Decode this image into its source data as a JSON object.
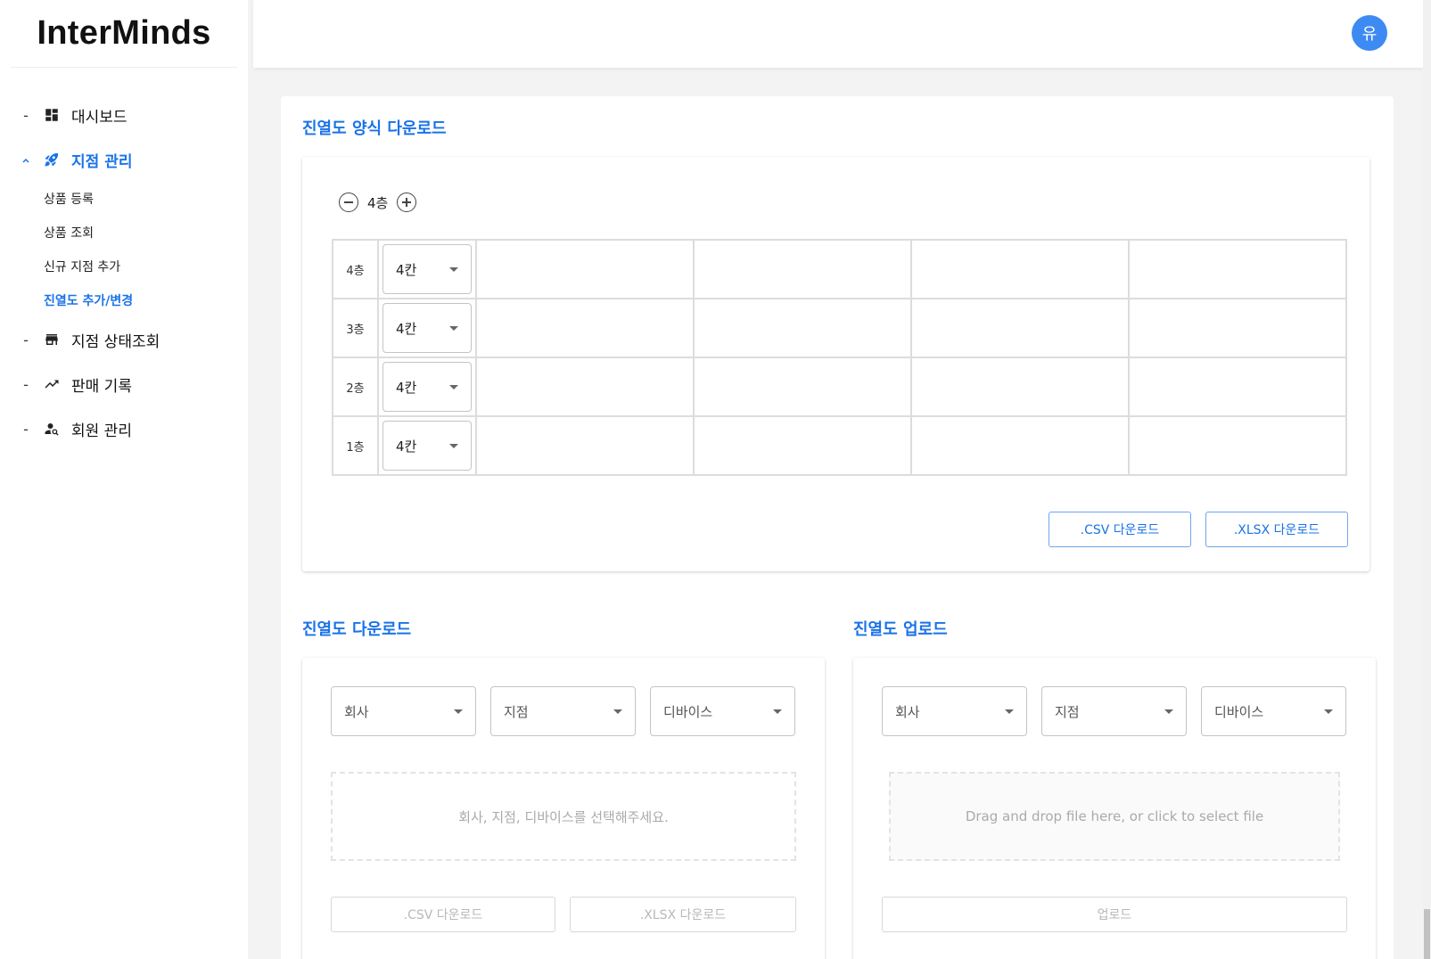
{
  "app": {
    "brand": "InterMinds",
    "avatar_initial": "유"
  },
  "sidebar": {
    "items": [
      {
        "bullet": "-",
        "icon": "dashboard-icon",
        "label": "대시보드"
      },
      {
        "bullet": "^",
        "icon": "rocket-icon",
        "label": "지점 관리",
        "active": true
      },
      {
        "bullet": "-",
        "icon": "store-icon",
        "label": "지점 상태조회"
      },
      {
        "bullet": "-",
        "icon": "trending-up-icon",
        "label": "판매 기록"
      },
      {
        "bullet": "-",
        "icon": "manage-accounts-icon",
        "label": "회원 관리"
      }
    ],
    "sub_items": [
      {
        "label": "상품 등록"
      },
      {
        "label": "상품 조회"
      },
      {
        "label": "신규 지점 추가"
      },
      {
        "label": "진열도 추가/변경",
        "active": true
      }
    ]
  },
  "template_section": {
    "title": "진열도 양식 다운로드",
    "floor_count_label": "4층",
    "rows": [
      {
        "floor": "4층",
        "columns": "4칸"
      },
      {
        "floor": "3층",
        "columns": "4칸"
      },
      {
        "floor": "2층",
        "columns": "4칸"
      },
      {
        "floor": "1층",
        "columns": "4칸"
      }
    ],
    "csv_button": ".CSV 다운로드",
    "xlsx_button": ".XLSX 다운로드"
  },
  "download_section": {
    "title": "진열도 다운로드",
    "company_placeholder": "회사",
    "branch_placeholder": "지점",
    "device_placeholder": "디바이스",
    "message": "회사, 지점, 디바이스를 선택해주세요.",
    "csv_button": ".CSV 다운로드",
    "xlsx_button": ".XLSX 다운로드"
  },
  "upload_section": {
    "title": "진열도 업로드",
    "company_placeholder": "회사",
    "branch_placeholder": "지점",
    "device_placeholder": "디바이스",
    "dropzone_text": "Drag and drop file here, or click to select file",
    "upload_button": "업로드"
  },
  "colors": {
    "accent": "#1a73e8",
    "avatar": "#3d8bf2"
  }
}
